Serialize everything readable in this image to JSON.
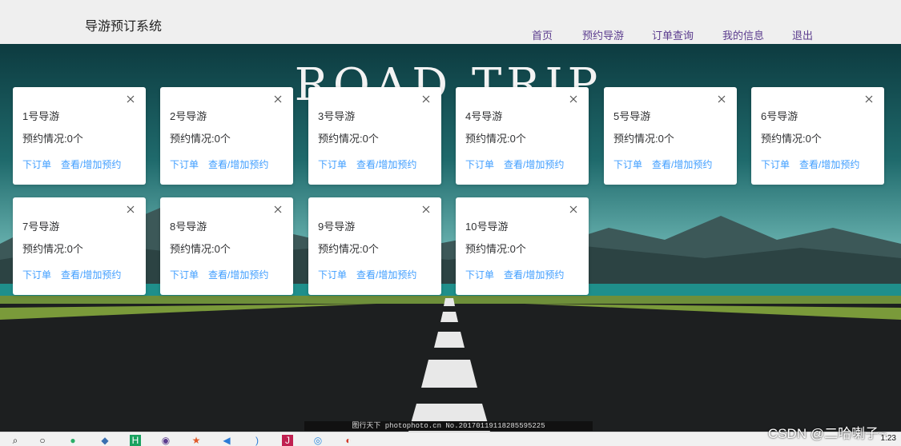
{
  "header": {
    "title": "导游预订系统",
    "nav": [
      {
        "label": "首页"
      },
      {
        "label": "预约导游"
      },
      {
        "label": "订单查询"
      },
      {
        "label": "我的信息"
      },
      {
        "label": "退出"
      }
    ]
  },
  "banner": {
    "text": "ROAD TRIP"
  },
  "cards": [
    {
      "name": "1号导游",
      "status": "预约情况:0个",
      "order": "下订单",
      "view": "查看/增加预约"
    },
    {
      "name": "2号导游",
      "status": "预约情况:0个",
      "order": "下订单",
      "view": "查看/增加预约"
    },
    {
      "name": "3号导游",
      "status": "预约情况:0个",
      "order": "下订单",
      "view": "查看/增加预约"
    },
    {
      "name": "4号导游",
      "status": "预约情况:0个",
      "order": "下订单",
      "view": "查看/增加预约"
    },
    {
      "name": "5号导游",
      "status": "预约情况:0个",
      "order": "下订单",
      "view": "查看/增加预约"
    },
    {
      "name": "6号导游",
      "status": "预约情况:0个",
      "order": "下订单",
      "view": "查看/增加预约"
    },
    {
      "name": "7号导游",
      "status": "预约情况:0个",
      "order": "下订单",
      "view": "查看/增加预约"
    },
    {
      "name": "8号导游",
      "status": "预约情况:0个",
      "order": "下订单",
      "view": "查看/增加预约"
    },
    {
      "name": "9号导游",
      "status": "预约情况:0个",
      "order": "下订单",
      "view": "查看/增加预约"
    },
    {
      "name": "10号导游",
      "status": "预约情况:0个",
      "order": "下订单",
      "view": "查看/增加预约"
    }
  ],
  "stock_watermark": "图行天下 photophoto.cn No.20170119118285595225",
  "csdn_watermark": "CSDN @二哈喇子~",
  "clock": "1:23",
  "colors": {
    "link": "#409eff",
    "nav": "#5b3c8e"
  }
}
